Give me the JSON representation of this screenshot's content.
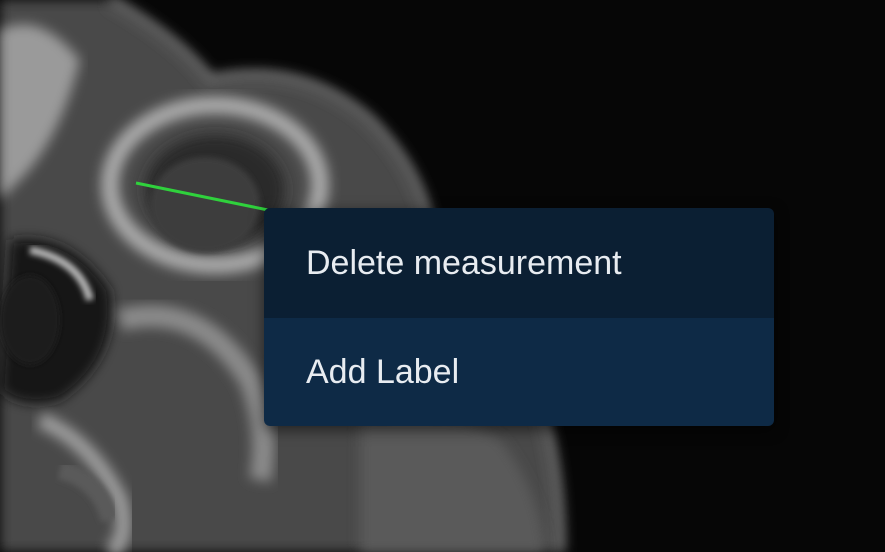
{
  "colors": {
    "measurement_line": "#2fd13c",
    "menu_item_bg": "#0b1f33",
    "menu_item_hover_bg": "#0e2a46",
    "menu_text": "#e8ecf1"
  },
  "context_menu": {
    "items": [
      {
        "label": "Delete measurement"
      },
      {
        "label": "Add Label"
      }
    ]
  }
}
